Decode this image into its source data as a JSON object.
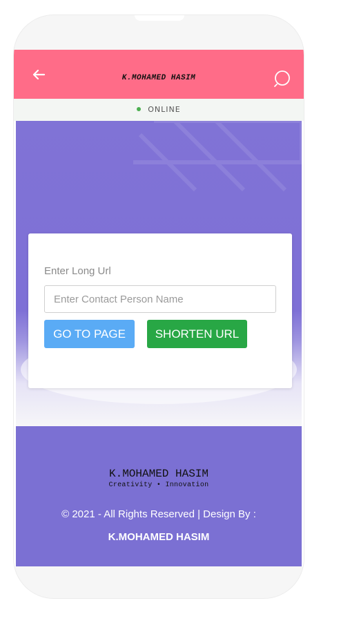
{
  "header": {
    "title": "K.MOHAMED HASIM",
    "back_icon": "arrow-left-icon",
    "search_icon": "search-icon",
    "color": "#ff6c88"
  },
  "status": {
    "label": "ONLINE",
    "dot_color": "#4caf50"
  },
  "form": {
    "label": "Enter Long Url",
    "input_placeholder": "Enter Contact Person Name",
    "input_value": "",
    "go_button": "GO TO PAGE",
    "shorten_button": "SHORTEN URL",
    "go_color": "#5aabf5",
    "shorten_color": "#28a745"
  },
  "footer": {
    "logo": "K.MOHAMED HASIM",
    "tagline": "Creativity • Innovation",
    "copyright": "© 2021 - All Rights Reserved | Design By :",
    "author": "K.MOHAMED HASIM",
    "background": "#7b70d3"
  }
}
